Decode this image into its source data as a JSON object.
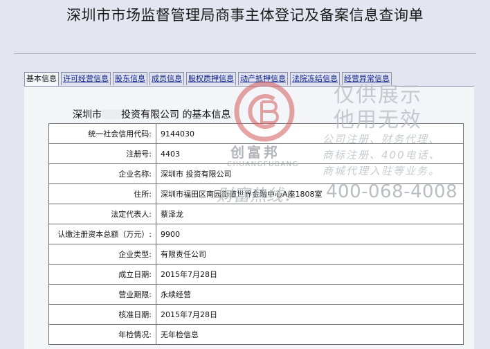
{
  "title": "深圳市市场监督管理局商事主体登记及备案信息查询单",
  "tabs": [
    {
      "label": "基本信息",
      "active": true
    },
    {
      "label": "许可经营信息",
      "active": false
    },
    {
      "label": "股东信息",
      "active": false
    },
    {
      "label": "成员信息",
      "active": false
    },
    {
      "label": "股权质押信息",
      "active": false
    },
    {
      "label": "动产抵押信息",
      "active": false
    },
    {
      "label": "法院冻结信息",
      "active": false
    },
    {
      "label": "经营异常信息",
      "active": false
    }
  ],
  "company_heading": {
    "prefix": "深圳市",
    "suffix": "投资有限公司",
    "tail": " 的基本信息"
  },
  "rows": [
    {
      "label": "统一社会信用代码:",
      "value": "9144030"
    },
    {
      "label": "注册号:",
      "value": "4403"
    },
    {
      "label": "企业名称:",
      "value": "深圳市          投资有限公司"
    },
    {
      "label": "住所:",
      "value": "深圳市福田区南园街道世界金融中心A座1808室"
    },
    {
      "label": "法定代表人:",
      "value": "蔡泽龙"
    },
    {
      "label": "认缴注册资本总额（万元）:",
      "value": "9900"
    },
    {
      "label": "企业类型:",
      "value": "有限责任公司"
    },
    {
      "label": "成立日期:",
      "value": "2015年7月28日"
    },
    {
      "label": "营业期限:",
      "value": "永续经营"
    },
    {
      "label": "核准日期:",
      "value": "2015年7月28日"
    },
    {
      "label": "年检情况:",
      "value": "无年检信息"
    }
  ],
  "watermark": {
    "line1": "仅供展示",
    "line2": "他用无效",
    "line3": "公司注册、财务代理、",
    "line4": "商标注册、400电话、",
    "line5": "商城代理入驻等业务。",
    "hotline_label": "财富热线：",
    "hotline_number": "400-068-4008",
    "logo_cn": "创富邦",
    "logo_en": "CHUANGFUBANG"
  },
  "colors": {
    "background": "#e3e6f1",
    "tab_link": "#0b1f8a",
    "logo_red": "#d35b5b"
  }
}
